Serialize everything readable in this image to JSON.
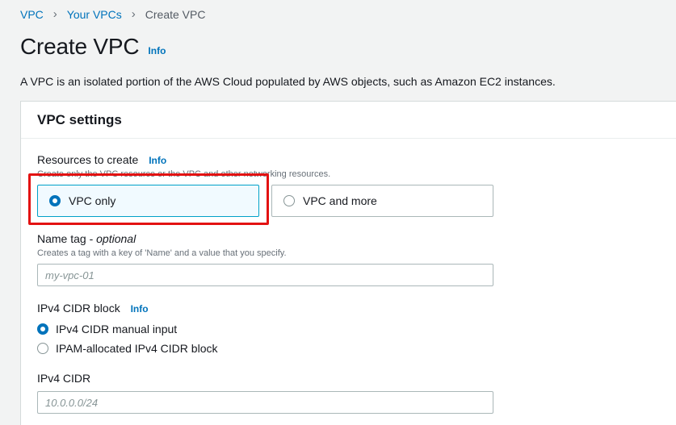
{
  "breadcrumb": {
    "items": [
      "VPC",
      "Your VPCs"
    ],
    "current": "Create VPC"
  },
  "page": {
    "title": "Create VPC",
    "info": "Info",
    "description": "A VPC is an isolated portion of the AWS Cloud populated by AWS objects, such as Amazon EC2 instances."
  },
  "settings": {
    "header": "VPC settings",
    "resources": {
      "label": "Resources to create",
      "info": "Info",
      "hint": "Create only the VPC resource or the VPC and other networking resources.",
      "options": [
        "VPC only",
        "VPC and more"
      ],
      "selected": "VPC only"
    },
    "name_tag": {
      "label": "Name tag - ",
      "optional": "optional",
      "hint": "Creates a tag with a key of 'Name' and a value that you specify.",
      "placeholder": "my-vpc-01",
      "value": ""
    },
    "ipv4_block": {
      "label": "IPv4 CIDR block",
      "info": "Info",
      "options": [
        "IPv4 CIDR manual input",
        "IPAM-allocated IPv4 CIDR block"
      ],
      "selected": "IPv4 CIDR manual input"
    },
    "ipv4_cidr": {
      "label": "IPv4 CIDR",
      "placeholder": "10.0.0.0/24",
      "value": ""
    }
  },
  "colors": {
    "link": "#0073bb",
    "selected_border": "#00a1c9",
    "highlight": "#e31212"
  }
}
